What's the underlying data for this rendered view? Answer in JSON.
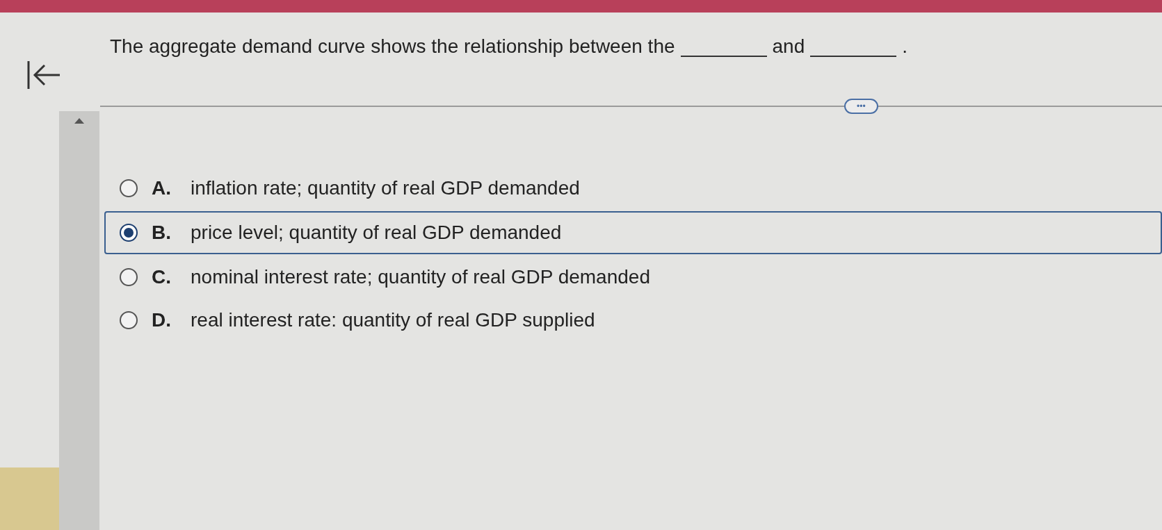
{
  "question": {
    "parts": [
      {
        "kind": "text",
        "text": "The aggregate demand curve shows the relationship between the"
      },
      {
        "kind": "blank"
      },
      {
        "kind": "text",
        "text": "and"
      },
      {
        "kind": "blank"
      },
      {
        "kind": "text",
        "text": "."
      }
    ]
  },
  "more_button": {
    "label": "•••"
  },
  "options": [
    {
      "letter": "A.",
      "text": "inflation rate; quantity of real GDP demanded",
      "selected": false
    },
    {
      "letter": "B.",
      "text": "price level; quantity of real GDP demanded",
      "selected": true
    },
    {
      "letter": "C.",
      "text": "nominal interest rate; quantity of real GDP demanded",
      "selected": false
    },
    {
      "letter": "D.",
      "text": "real interest rate: quantity of real GDP supplied",
      "selected": false
    }
  ]
}
